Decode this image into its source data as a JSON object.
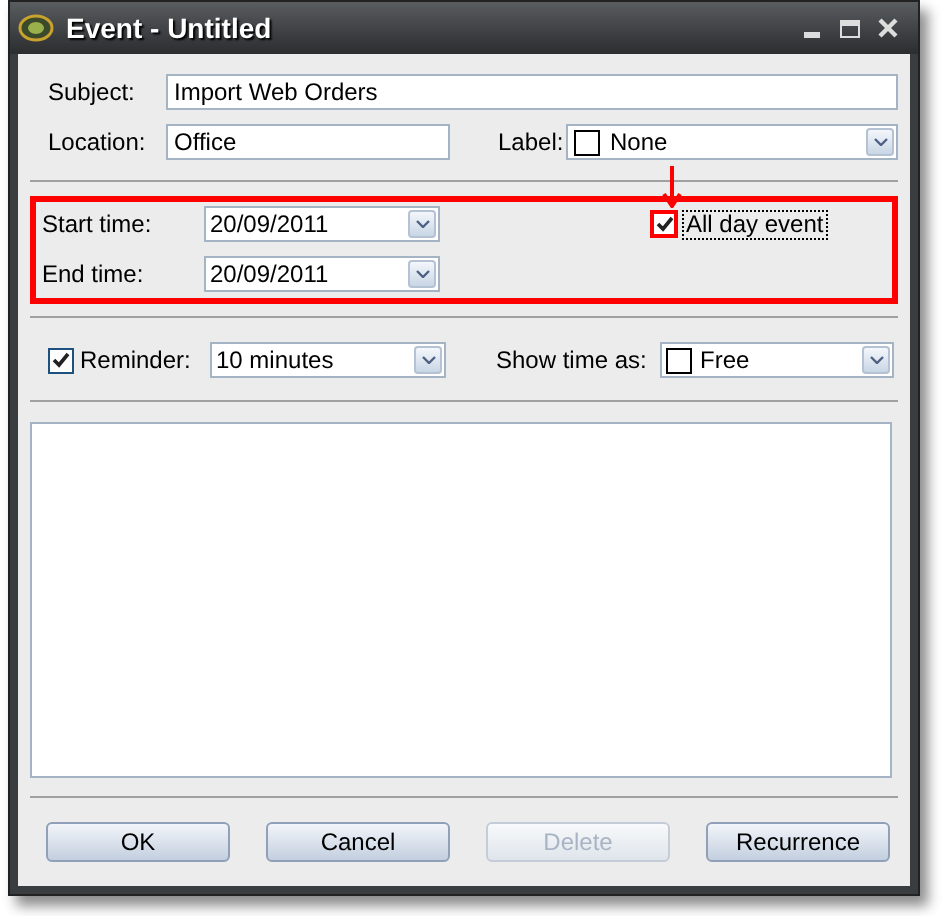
{
  "window": {
    "title": "Event - Untitled"
  },
  "subject": {
    "label": "Subject:",
    "value": "Import Web Orders"
  },
  "location": {
    "label": "Location:",
    "value": "Office"
  },
  "label_field": {
    "label": "Label:",
    "value": "None"
  },
  "start_time": {
    "label": "Start time:",
    "value": "20/09/2011"
  },
  "end_time": {
    "label": "End time:",
    "value": "20/09/2011"
  },
  "all_day": {
    "label": "All day event",
    "checked": true
  },
  "reminder": {
    "label": "Reminder:",
    "checked": true,
    "value": "10 minutes"
  },
  "show_time_as": {
    "label": "Show time as:",
    "value": "Free"
  },
  "buttons": [
    {
      "label": "OK",
      "disabled": false
    },
    {
      "label": "Cancel",
      "disabled": false
    },
    {
      "label": "Delete",
      "disabled": true
    },
    {
      "label": "Recurrence",
      "disabled": false
    }
  ]
}
